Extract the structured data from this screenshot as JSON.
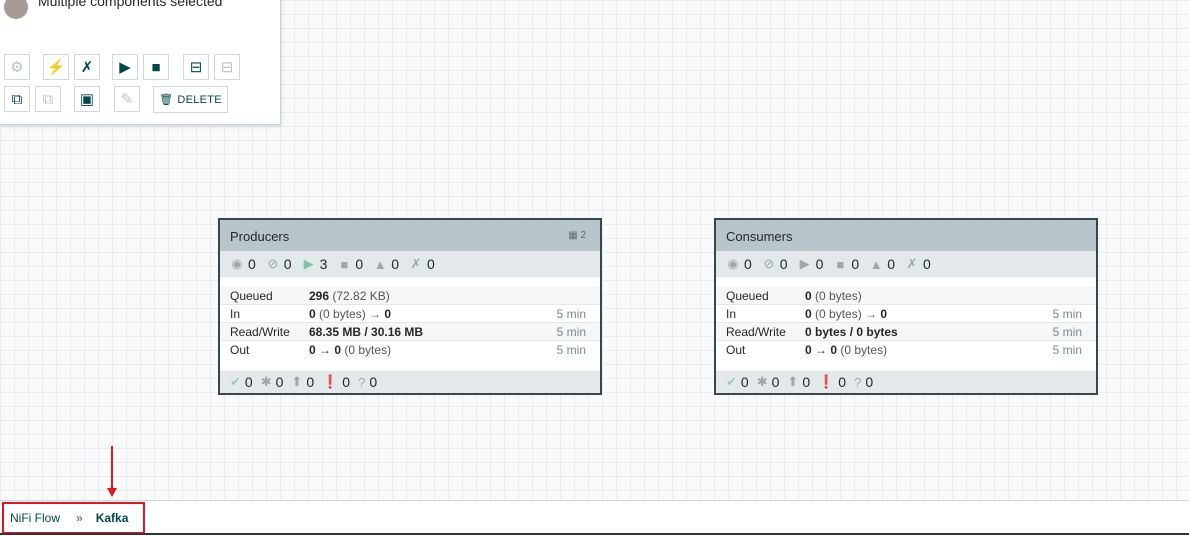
{
  "palette": {
    "selection_text": "Multiple components selected",
    "delete_label": "DELETE"
  },
  "groups": [
    {
      "name": "Producers",
      "version_count": "2",
      "stats": {
        "transmitting": "0",
        "not_transmitting": "0",
        "running": "3",
        "stopped": "0",
        "invalid": "0",
        "disabled": "0"
      },
      "rows": [
        {
          "label": "Queued",
          "value_bold": "296",
          "value_rest": " (72.82 KB)",
          "time": ""
        },
        {
          "label": "In",
          "value_bold": "0",
          "value_rest": " (0 bytes) → ",
          "value_tail": "0",
          "time": "5 min"
        },
        {
          "label": "Read/Write",
          "value_bold": "68.35 MB / 30.16 MB",
          "value_rest": "",
          "time": "5 min"
        },
        {
          "label": "Out",
          "value_bold": "0",
          "value_rest": " → ",
          "value_tail": "0",
          "value_end": " (0 bytes)",
          "time": "5 min"
        }
      ],
      "footer": {
        "up_to_date": "0",
        "locally_modified": "0",
        "stale": "0",
        "sync_failure": "0",
        "unknown": "0"
      }
    },
    {
      "name": "Consumers",
      "stats": {
        "transmitting": "0",
        "not_transmitting": "0",
        "running": "0",
        "stopped": "0",
        "invalid": "0",
        "disabled": "0"
      },
      "rows": [
        {
          "label": "Queued",
          "value_bold": "0",
          "value_rest": " (0 bytes)",
          "time": ""
        },
        {
          "label": "In",
          "value_bold": "0",
          "value_rest": " (0 bytes) → ",
          "value_tail": "0",
          "time": "5 min"
        },
        {
          "label": "Read/Write",
          "value_bold": "0 bytes / 0 bytes",
          "value_rest": "",
          "time": "5 min"
        },
        {
          "label": "Out",
          "value_bold": "0",
          "value_rest": " → ",
          "value_tail": "0",
          "value_end": " (0 bytes)",
          "time": "5 min"
        }
      ],
      "footer": {
        "up_to_date": "0",
        "locally_modified": "0",
        "stale": "0",
        "sync_failure": "0",
        "unknown": "0"
      }
    }
  ],
  "breadcrumb": {
    "root": "NiFi Flow",
    "separator": "»",
    "current": "Kafka"
  },
  "colors": {
    "accent": "#004849",
    "annotation": "#e3161f",
    "header": "#b8c5cb"
  }
}
